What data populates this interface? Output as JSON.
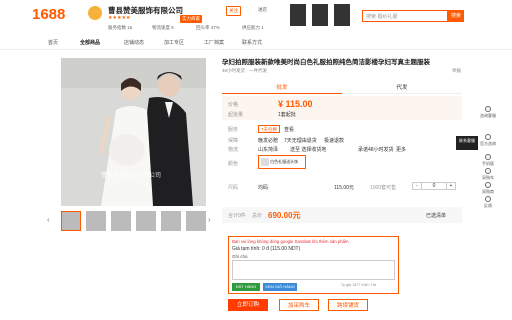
{
  "topbar": {
    "logo": "1688",
    "shop_name": "曹县赞美服饰有限公司",
    "metric_1": "服务指数 16",
    "metric_2": "物流速度 5",
    "metric_3": "回头率 47%",
    "metric_4": "供应能力 1",
    "tag_1": "实力商家",
    "tag_2": "关注",
    "follow": "进店",
    "search_placeholder": "搜索 婚纱礼服",
    "search_btn": "搜索"
  },
  "nav": {
    "items": [
      "首页",
      "全部商品",
      "店铺动态",
      "加工专区",
      "工厂档案",
      "联系方式"
    ]
  },
  "product": {
    "title": "孕妇拍照服装新款唯美时尚白色礼服拍照纯色简洁影楼孕妇写真主题服装",
    "subtitle": "48小时发货 · 一件代发",
    "side_note": "举报",
    "tab_1": "批发",
    "tab_2": "代发",
    "price_label": "价格",
    "price": "¥ 115.00",
    "min_label": "起批量",
    "min_value": "1套起批",
    "service_label": "服务",
    "service_tag": "7天包换",
    "service_more": "查看",
    "guarantee_label": "保障",
    "guarantee_1": "晚发必赔",
    "guarantee_2": "7天无理由退货",
    "guarantee_3": "极速退款",
    "ship_label": "物流",
    "ship_from": "山东菏泽",
    "ship_to": "送至 选择收货地",
    "ship_fee": "运费 ¥5 起",
    "ship_time": "承诺48小时发货",
    "ship_more": "更多",
    "color_label": "颜色",
    "color_option": "白色礼服送头饰",
    "size_label": "尺码",
    "size_value": "均码",
    "size_price": "115.00元",
    "size_stock": "1000套可售",
    "qty": "0",
    "qty_minus": "-",
    "qty_plus": "+",
    "summary_label": "合计0件",
    "summary_amount_label": "总价",
    "total": "690.00元",
    "selected": "已选清单"
  },
  "ext": {
    "note": "Bạn vui lòng không dùng google translate khi thêm sản phẩm",
    "price_line": "Giá tạm tính: 0 đ (115.00 NDT)",
    "comment_label": "Ghi chú",
    "add_btn": "ĐẶT HÀNG",
    "cart_btn": "XEM GIỎ HÀNG",
    "footer": "Tỷ giá: 3477 Vnđ / 1 tệ"
  },
  "actions": {
    "buy": "立即订购",
    "cart": "加采购车",
    "share": "跨境铺货"
  },
  "sidebar": {
    "items": [
      "咨询客服",
      "官方咨询",
      "手机版",
      "采购车",
      "采购商",
      "反馈"
    ],
    "tooltip": "联系客服"
  },
  "watermark": "曹县赞美服饰有限公司",
  "colors": {
    "accent": "#ff5a00",
    "price": "#ff5a00"
  }
}
